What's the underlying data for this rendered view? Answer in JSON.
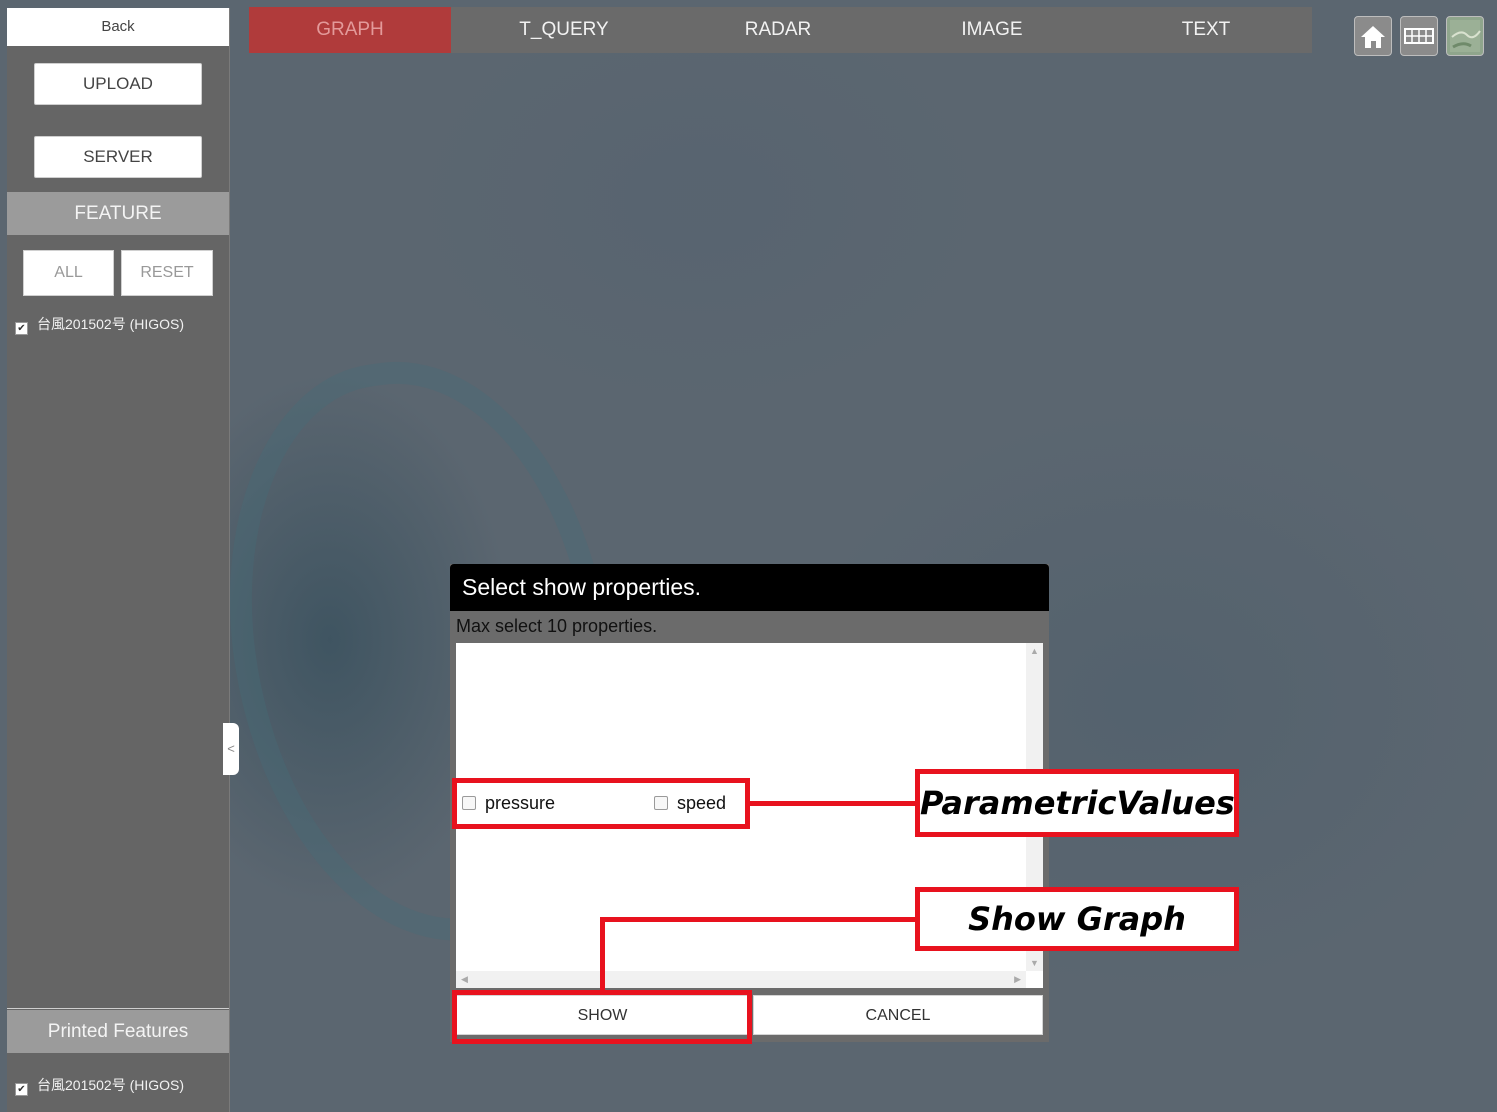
{
  "sidebar": {
    "back_label": "Back",
    "upload_label": "UPLOAD",
    "server_label": "SERVER",
    "feature_header": "FEATURE",
    "all_label": "ALL",
    "reset_label": "RESET",
    "feature_items": [
      {
        "label": "台風201502号 (HIGOS)",
        "checked": true
      }
    ],
    "printed_header": "Printed Features",
    "printed_items": [
      {
        "label": "台風201502号 (HIGOS)",
        "checked": true
      }
    ],
    "collapse_label": "<"
  },
  "tabs": [
    {
      "label": "GRAPH",
      "active": true
    },
    {
      "label": "T_QUERY",
      "active": false
    },
    {
      "label": "RADAR",
      "active": false
    },
    {
      "label": "IMAGE",
      "active": false
    },
    {
      "label": "TEXT",
      "active": false
    }
  ],
  "corner_icons": [
    "home-icon",
    "grid-icon",
    "map-thumbnail-icon"
  ],
  "dialog": {
    "title": "Select show properties.",
    "subtitle": "Max select 10 properties.",
    "properties": [
      {
        "label": "pressure",
        "checked": false
      },
      {
        "label": "speed",
        "checked": false
      }
    ],
    "show_label": "SHOW",
    "cancel_label": "CANCEL"
  },
  "annotations": {
    "parametric_values": "ParametricValues",
    "show_graph": "Show Graph"
  },
  "colors": {
    "active_tab": "#b03b3b",
    "annotation_red": "#e8121e",
    "dialog_title_bg": "#000000"
  }
}
